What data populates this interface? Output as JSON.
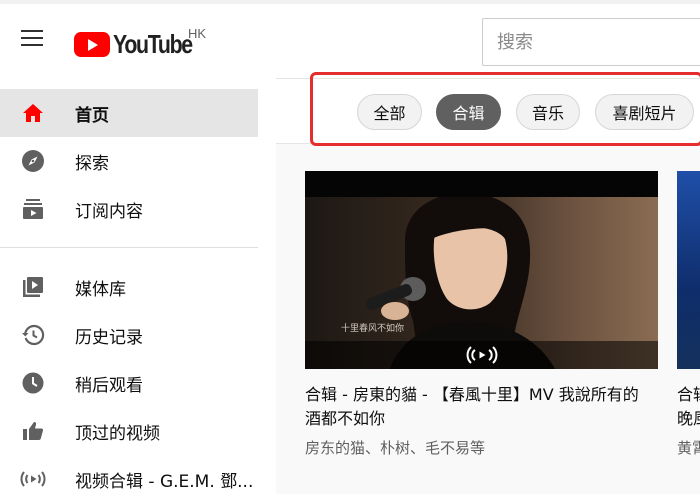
{
  "header": {
    "logo_text": "YouTube",
    "region": "HK",
    "search_placeholder": "搜索"
  },
  "sidebar": {
    "items": [
      {
        "label": "首页",
        "icon": "home-icon",
        "active": true
      },
      {
        "label": "探索",
        "icon": "compass-icon"
      },
      {
        "label": "订阅内容",
        "icon": "subscriptions-icon"
      },
      {
        "label": "媒体库",
        "icon": "library-icon"
      },
      {
        "label": "历史记录",
        "icon": "history-icon"
      },
      {
        "label": "稍后观看",
        "icon": "watch-later-icon"
      },
      {
        "label": "顶过的视频",
        "icon": "thumbs-up-icon"
      },
      {
        "label": "视频合辑 - G.E.M. 鄧...",
        "icon": "mix-icon"
      }
    ]
  },
  "chips": [
    {
      "label": "全部"
    },
    {
      "label": "合辑",
      "selected": true
    },
    {
      "label": "音乐"
    },
    {
      "label": "喜剧短片"
    }
  ],
  "videos": [
    {
      "title": "合辑 - 房東的貓 - 【春風十里】MV 我說所有的酒都不如你",
      "meta": "房东的猫、朴树、毛不易等",
      "thumb_caption": "十里春风不如你"
    },
    {
      "title": "合辑 晚風",
      "meta": "黄霄"
    }
  ],
  "colors": {
    "brand_red": "#ff0000",
    "highlight_border": "#e52d2d",
    "selected_chip": "#606060"
  }
}
